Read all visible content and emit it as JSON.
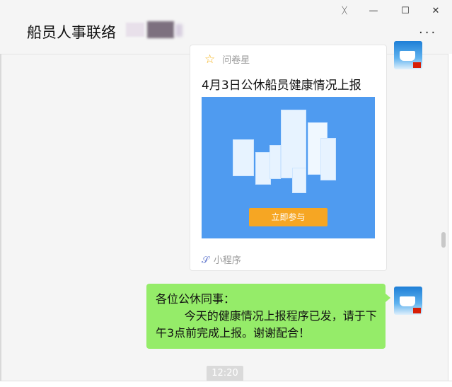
{
  "window": {
    "title": "船员人事联络",
    "controls": {
      "pin": "ᚷ",
      "minimize": "—",
      "maximize": "☐",
      "close": "✕"
    },
    "more": "···"
  },
  "card": {
    "source": "问卷星",
    "source_icon": "star-icon",
    "title": "4月3日公休船员健康情况上报",
    "button": "立即参与",
    "footer": "小程序",
    "footer_icon": "mini-program-icon"
  },
  "message": {
    "text": "各位公休同事：\n        今天的健康情况上报程序已发，请于下午3点前完成上报。谢谢配合！"
  },
  "time": "12:20",
  "colors": {
    "bubble": "#95ec69",
    "banner": "#4f9bf0",
    "button": "#f6a623"
  }
}
